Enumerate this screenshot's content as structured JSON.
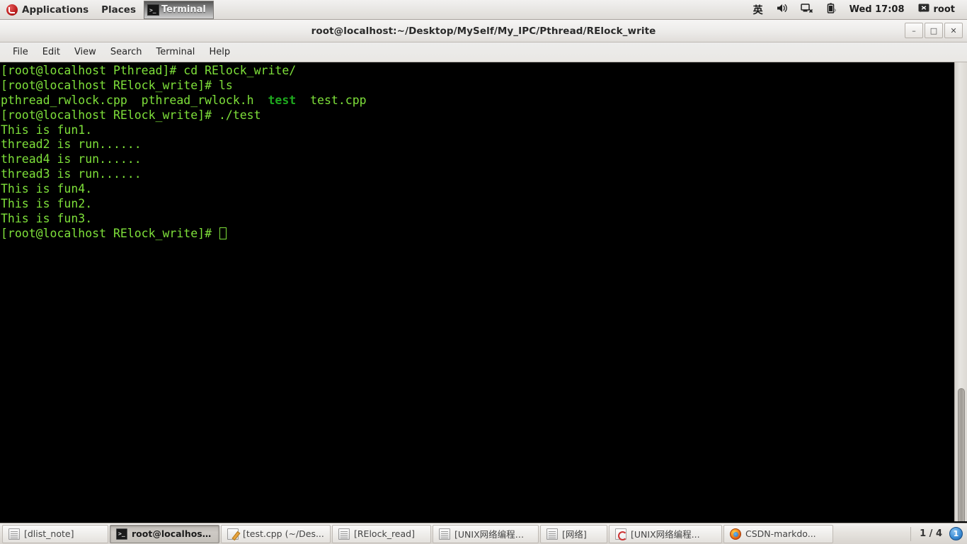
{
  "top_panel": {
    "logo": "fedora-logo",
    "menus": [
      {
        "label": "Applications",
        "name": "applications-menu"
      },
      {
        "label": "Places",
        "name": "places-menu"
      }
    ],
    "window_button": {
      "label": "Terminal",
      "icon": "terminal-icon"
    },
    "tray": {
      "ime": "英",
      "volume_icon": "volume-icon",
      "network_icon": "network-disconnected-icon",
      "battery_icon": "battery-icon",
      "clock": "Wed 17:08",
      "message_icon": "message-icon",
      "user": "root"
    }
  },
  "window": {
    "title": "root@localhost:~/Desktop/MySelf/My_IPC/Pthread/RElock_write",
    "controls": {
      "minimize": "–",
      "maximize": "□",
      "close": "✕"
    },
    "menubar": [
      "File",
      "Edit",
      "View",
      "Search",
      "Terminal",
      "Help"
    ]
  },
  "terminal": {
    "background": "#000000",
    "foreground": "#7ee03a",
    "exec_color": "#1ea81e",
    "lines": [
      {
        "segments": [
          {
            "text": "[root@localhost Pthread]# cd RElock_write/",
            "style": "bright"
          }
        ]
      },
      {
        "segments": [
          {
            "text": "[root@localhost RElock_write]# ls",
            "style": "bright"
          }
        ]
      },
      {
        "segments": [
          {
            "text": "pthread_rwlock.cpp  pthread_rwlock.h  ",
            "style": "bright"
          },
          {
            "text": "test",
            "style": "exec"
          },
          {
            "text": "  test.cpp",
            "style": "bright"
          }
        ]
      },
      {
        "segments": [
          {
            "text": "[root@localhost RElock_write]# ./test",
            "style": "bright"
          }
        ]
      },
      {
        "segments": [
          {
            "text": "This is fun1.",
            "style": "bright"
          }
        ]
      },
      {
        "segments": [
          {
            "text": "thread2 is run......",
            "style": "bright"
          }
        ]
      },
      {
        "segments": [
          {
            "text": "thread4 is run......",
            "style": "bright"
          }
        ]
      },
      {
        "segments": [
          {
            "text": "thread3 is run......",
            "style": "bright"
          }
        ]
      },
      {
        "segments": [
          {
            "text": "This is fun4.",
            "style": "bright"
          }
        ]
      },
      {
        "segments": [
          {
            "text": "This is fun2.",
            "style": "bright"
          }
        ]
      },
      {
        "segments": [
          {
            "text": "This is fun3.",
            "style": "bright"
          }
        ]
      },
      {
        "segments": [
          {
            "text": "[root@localhost RElock_write]# ",
            "style": "bright"
          },
          {
            "cursor": true
          }
        ]
      }
    ]
  },
  "taskbar": {
    "items": [
      {
        "label": "[dlist_note]",
        "icon": "document-icon",
        "active": false,
        "name": "taskbar-item-dlist-note"
      },
      {
        "label": "root@localhost:...",
        "icon": "terminal-icon",
        "active": true,
        "name": "taskbar-item-terminal"
      },
      {
        "label": "[test.cpp (~/Des...",
        "icon": "text-editor-icon",
        "active": false,
        "name": "taskbar-item-test-cpp"
      },
      {
        "label": "[RElock_read]",
        "icon": "document-icon",
        "active": false,
        "name": "taskbar-item-relock-read"
      },
      {
        "label": "[UNIX网络编程程...",
        "icon": "document-icon",
        "active": false,
        "name": "taskbar-item-unix-net-1"
      },
      {
        "label": "[网络]",
        "icon": "document-icon",
        "active": false,
        "name": "taskbar-item-network"
      },
      {
        "label": "[UNIX网络编程...",
        "icon": "pdf-icon",
        "active": false,
        "name": "taskbar-item-unix-net-2"
      },
      {
        "label": "CSDN-markdo...",
        "icon": "firefox-icon",
        "active": false,
        "name": "taskbar-item-firefox"
      }
    ],
    "workspace_text": "1 / 4",
    "workspace_badge": "1"
  }
}
